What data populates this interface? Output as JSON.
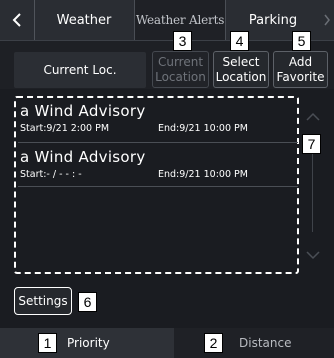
{
  "tabs": {
    "weather": "Weather",
    "alerts": "Weather Alerts",
    "parking": "Parking"
  },
  "location": {
    "current_label": "Current Loc.",
    "buttons": {
      "current_location": [
        "Current",
        "Location"
      ],
      "select_location": [
        "Select",
        "Location"
      ],
      "add_favorite": [
        "Add",
        "Favorite"
      ]
    }
  },
  "alerts": [
    {
      "title": "a Wind Advisory",
      "start": "Start:9/21 2:00 PM",
      "end": "End:9/21 10:00 PM"
    },
    {
      "title": "a Wind Advisory",
      "start": "Start:- / - - : -",
      "end": "End:9/21 10:00 PM"
    }
  ],
  "settings_label": "Settings",
  "sort": {
    "priority": "Priority",
    "distance": "Distance"
  },
  "callouts": [
    "1",
    "2",
    "3",
    "4",
    "5",
    "6",
    "7"
  ],
  "icons": {
    "back": "chevron-left-icon",
    "forward": "chevron-right-icon",
    "scroll_up": "chevron-up-icon",
    "scroll_down": "chevron-down-icon"
  },
  "colors": {
    "background": "#1a1c21",
    "tabbar": "#2a2d33",
    "disabled_text": "#6f737a"
  }
}
